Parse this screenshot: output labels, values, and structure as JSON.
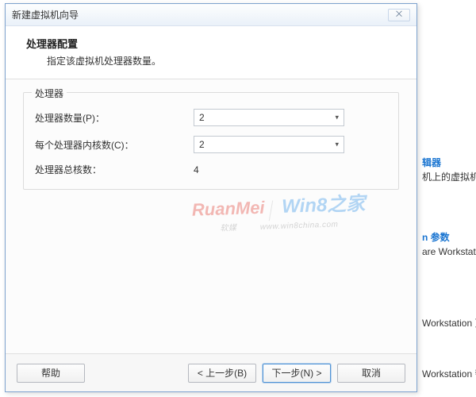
{
  "dialog": {
    "title": "新建虚拟机向导",
    "close_glyph": "⨉",
    "header": {
      "title": "处理器配置",
      "subtitle": "指定该虚拟机处理器数量。"
    },
    "group": {
      "label": "处理器",
      "proc_count_label": "处理器数量(P)：",
      "proc_count_value": "2",
      "cores_label": "每个处理器内核数(C)：",
      "cores_value": "2",
      "total_label": "处理器总核数：",
      "total_value": "4"
    },
    "buttons": {
      "help": "帮助",
      "back": "< 上一步(B)",
      "next": "下一步(N) >",
      "cancel": "取消"
    }
  },
  "watermark": {
    "left_brand": "RuanMei",
    "left_sub": "软媒",
    "right_brand": "Win8之家",
    "right_sub": "www.win8china.com"
  },
  "background": {
    "item1_suffix": "辑器",
    "item1_desc": "机上的虚拟机的网",
    "item2_link": "n  参数",
    "item2_desc": "are Workstation 设",
    "item3_desc": "Workstation 更新",
    "item4_desc": "Workstation 帮助"
  }
}
